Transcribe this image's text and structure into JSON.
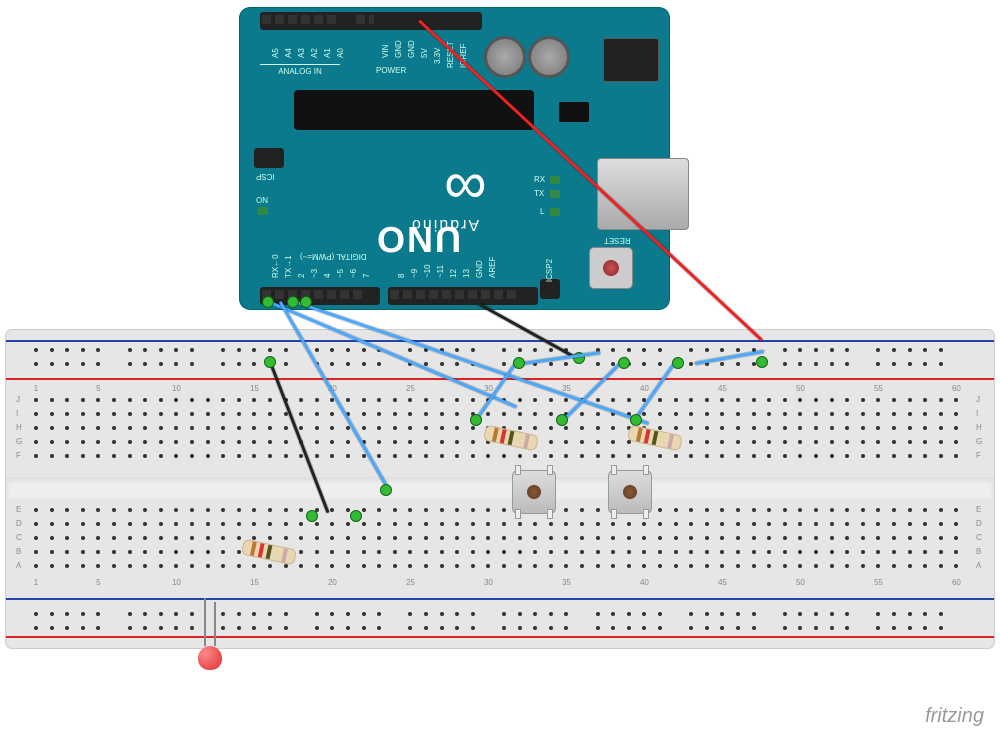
{
  "watermark": "fritzing",
  "arduino": {
    "brand": "Arduino",
    "model": "UNO",
    "sections": {
      "power": "POWER",
      "analog": "ANALOG IN",
      "digital": "DIGITAL  (PWM=~)"
    },
    "reset_label": "RESET",
    "icsp_label": "ICSP",
    "icsp2_label": "ICSP2",
    "leds": {
      "on": "ON",
      "l": "L",
      "tx": "TX",
      "rx": "RX"
    },
    "power_pins": [
      "IOREF",
      "RESET",
      "3.3V",
      "5V",
      "GND",
      "GND",
      "VIN"
    ],
    "analog_pins": [
      "A0",
      "A1",
      "A2",
      "A3",
      "A4",
      "A5"
    ],
    "digital_left": [
      "AREF",
      "GND",
      "13",
      "12",
      "~11",
      "~10",
      "~9",
      "8"
    ],
    "digital_right": [
      "7",
      "~6",
      "~5",
      "4",
      "~3",
      "2",
      "TX→1",
      "RX←0"
    ]
  },
  "breadboard": {
    "columns_start": 1,
    "columns_end": 60,
    "row_labels_top": [
      "J",
      "I",
      "H",
      "G",
      "F"
    ],
    "row_labels_bottom": [
      "E",
      "D",
      "C",
      "B",
      "A"
    ],
    "rail_top_plus_label": "+",
    "rail_top_minus_label": "−",
    "rail_bottom_plus_label": "+",
    "rail_bottom_minus_label": "−"
  },
  "components": {
    "led1": {
      "type": "LED",
      "color": "red"
    },
    "r_led": {
      "type": "resistor",
      "bands": [
        "#b73",
        "#d33",
        "#552",
        "#caa"
      ]
    },
    "r_btn1": {
      "type": "resistor",
      "bands": [
        "#b73",
        "#d33",
        "#552",
        "#caa"
      ]
    },
    "r_btn2": {
      "type": "resistor",
      "bands": [
        "#b73",
        "#d33",
        "#552",
        "#caa"
      ]
    },
    "btn1": {
      "type": "tactile-button"
    },
    "btn2": {
      "type": "tactile-button"
    }
  },
  "wires": [
    {
      "id": "5v-to-rail",
      "color": "red",
      "from": "Arduino 5V",
      "to": "breadboard top + rail"
    },
    {
      "id": "gnd-to-rail",
      "color": "black",
      "from": "Arduino GND (digital side)",
      "to": "breadboard top − rail"
    },
    {
      "id": "d0",
      "color": "blue",
      "from": "Arduino D0",
      "to": "breadboard"
    },
    {
      "id": "d2",
      "color": "blue",
      "from": "Arduino D2",
      "to": "breadboard"
    },
    {
      "id": "d3",
      "color": "blue",
      "from": "Arduino D3",
      "to": "breadboard"
    },
    {
      "id": "btn1-pull",
      "color": "blue",
      "from": "btn1 row",
      "to": "top rail"
    },
    {
      "id": "btn2-pull",
      "color": "blue",
      "from": "btn2 row",
      "to": "top rail"
    },
    {
      "id": "rail-jumper1",
      "color": "blue",
      "from": "top + rail",
      "to": "top + rail"
    },
    {
      "id": "rail-jumper2",
      "color": "blue",
      "from": "top + rail",
      "to": "top + rail"
    },
    {
      "id": "led-gnd",
      "color": "black",
      "from": "LED cathode col",
      "to": "top − rail"
    }
  ]
}
